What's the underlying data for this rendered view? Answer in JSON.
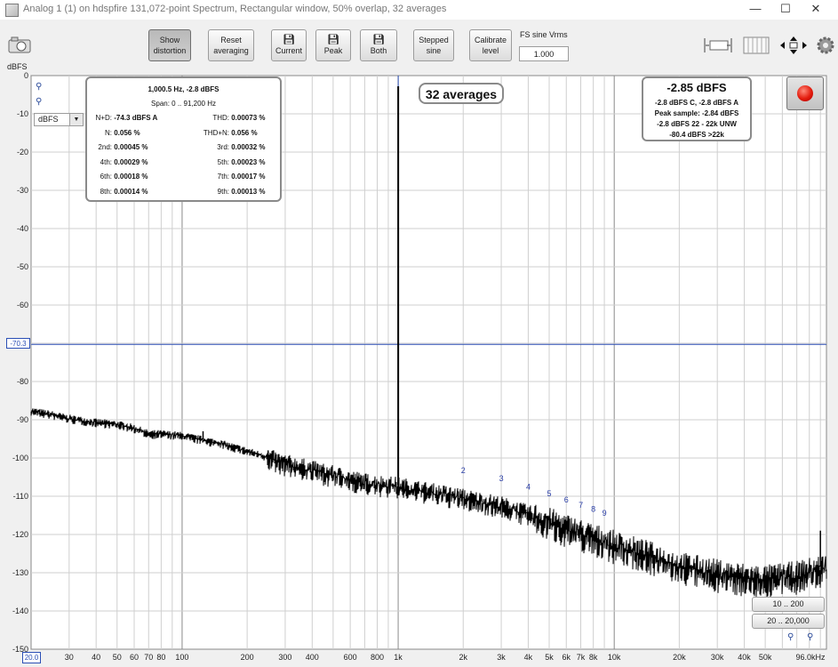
{
  "window": {
    "title": "Analog 1 (1) on hdspfire 131,072-point Spectrum, Rectangular window, 50% overlap, 32 averages",
    "controls": [
      "—",
      "☐",
      "✕"
    ]
  },
  "toolbar": {
    "show_distortion": "Show distortion",
    "reset_averaging": "Reset averaging",
    "current": "Current",
    "peak": "Peak",
    "both": "Both",
    "stepped_sine": "Stepped sine",
    "calibrate_level": "Calibrate level",
    "fs_sine_label": "FS sine Vrms",
    "fs_sine_value": "1.000"
  },
  "distortion": {
    "line1": "1,000.5 Hz, -2.8 dBFS",
    "line2": "Span: 0 .. 91,200 Hz",
    "rows": [
      {
        "l_label": "N+D:",
        "l_value": "-74.3 dBFS A",
        "r_label": "THD:",
        "r_value": "0.00073 %"
      },
      {
        "l_label": "N:",
        "l_value": "0.056 %",
        "r_label": "THD+N:",
        "r_value": "0.056 %"
      },
      {
        "l_label": "2nd:",
        "l_value": "0.00045 %",
        "r_label": "3rd:",
        "r_value": "0.00032 %"
      },
      {
        "l_label": "4th:",
        "l_value": "0.00029 %",
        "r_label": "5th:",
        "r_value": "0.00023 %"
      },
      {
        "l_label": "6th:",
        "l_value": "0.00018 %",
        "r_label": "7th:",
        "r_value": "0.00017 %"
      },
      {
        "l_label": "8th:",
        "l_value": "0.00014 %",
        "r_label": "9th:",
        "r_value": "0.00013 %"
      }
    ]
  },
  "averages_badge": "32 averages",
  "level_box": {
    "title": "-2.85 dBFS",
    "lines": [
      "-2.8 dBFS C, -2.8 dBFS A",
      "Peak sample: -2.84 dBFS",
      "-2.8 dBFS 22 - 22k UNW",
      "-80.4 dBFS >22k"
    ]
  },
  "unit_select": "dBFS",
  "range_buttons": [
    "10 .. 200",
    "20 .. 20,000"
  ],
  "cursor_label": "-70.3",
  "x_start_label": "20.0",
  "chart_data": {
    "type": "line",
    "title": "",
    "ylabel": "dBFS",
    "xlabel": "",
    "xscale": "log",
    "xlim": [
      20,
      96000
    ],
    "ylim": [
      -150,
      0
    ],
    "grid": true,
    "y_ticks": [
      "0",
      "-10",
      "-20",
      "-30",
      "-40",
      "-50",
      "-60",
      "-70",
      "-80",
      "-90",
      "-100",
      "-110",
      "-120",
      "-130",
      "-140",
      "-150"
    ],
    "x_ticks": [
      {
        "v": 30,
        "t": "30"
      },
      {
        "v": 40,
        "t": "40"
      },
      {
        "v": 50,
        "t": "50"
      },
      {
        "v": 60,
        "t": "60"
      },
      {
        "v": 70,
        "t": "70"
      },
      {
        "v": 80,
        "t": "80"
      },
      {
        "v": 100,
        "t": "100"
      },
      {
        "v": 200,
        "t": "200"
      },
      {
        "v": 300,
        "t": "300"
      },
      {
        "v": 400,
        "t": "400"
      },
      {
        "v": 600,
        "t": "600"
      },
      {
        "v": 800,
        "t": "800"
      },
      {
        "v": 1000,
        "t": "1k"
      },
      {
        "v": 2000,
        "t": "2k"
      },
      {
        "v": 3000,
        "t": "3k"
      },
      {
        "v": 4000,
        "t": "4k"
      },
      {
        "v": 5000,
        "t": "5k"
      },
      {
        "v": 6000,
        "t": "6k"
      },
      {
        "v": 7000,
        "t": "7k"
      },
      {
        "v": 8000,
        "t": "8k"
      },
      {
        "v": 10000,
        "t": "10k"
      },
      {
        "v": 20000,
        "t": "20k"
      },
      {
        "v": 30000,
        "t": "30k"
      },
      {
        "v": 40000,
        "t": "40k"
      },
      {
        "v": 50000,
        "t": "50k"
      },
      {
        "v": 96000,
        "t": "96.0kHz"
      }
    ],
    "cursor_y": -70.3,
    "series": [
      {
        "values": [
          [
            20,
            -87.5
          ],
          [
            25,
            -88.5
          ],
          [
            30,
            -89.5
          ],
          [
            40,
            -90.5
          ],
          [
            50,
            -91
          ],
          [
            60,
            -92
          ],
          [
            70,
            -93.5
          ],
          [
            80,
            -93.5
          ],
          [
            100,
            -94
          ],
          [
            150,
            -96
          ],
          [
            200,
            -98
          ],
          [
            300,
            -101
          ],
          [
            500,
            -104
          ],
          [
            700,
            -106
          ],
          [
            1000,
            -107
          ],
          [
            2000,
            -110
          ],
          [
            3000,
            -112
          ],
          [
            5000,
            -116
          ],
          [
            7000,
            -119
          ],
          [
            10000,
            -122
          ],
          [
            15000,
            -125
          ],
          [
            20000,
            -127.5
          ],
          [
            30000,
            -129.5
          ],
          [
            40000,
            -130.5
          ],
          [
            50000,
            -131
          ],
          [
            70000,
            -130
          ],
          [
            96000,
            -128
          ]
        ]
      }
    ],
    "fundamental": {
      "x": 1000.5,
      "y": -2.8
    },
    "spurs": [
      {
        "x": 125,
        "y": -93
      },
      {
        "x": 250,
        "y": -98
      },
      {
        "x": 90000,
        "y": -119
      }
    ],
    "harmonic_markers": [
      {
        "n": "2",
        "x": 2001
      },
      {
        "n": "3",
        "x": 3001.5
      },
      {
        "n": "4",
        "x": 4002
      },
      {
        "n": "5",
        "x": 5002.5
      },
      {
        "n": "6",
        "x": 6003
      },
      {
        "n": "7",
        "x": 7003.5
      },
      {
        "n": "8",
        "x": 8004
      },
      {
        "n": "9",
        "x": 9004.5
      }
    ],
    "colors": {
      "trace": "#000000",
      "markers": "#2b3fa8",
      "cursor": "#2b4fb5",
      "grid": "#c8c8c8"
    }
  }
}
